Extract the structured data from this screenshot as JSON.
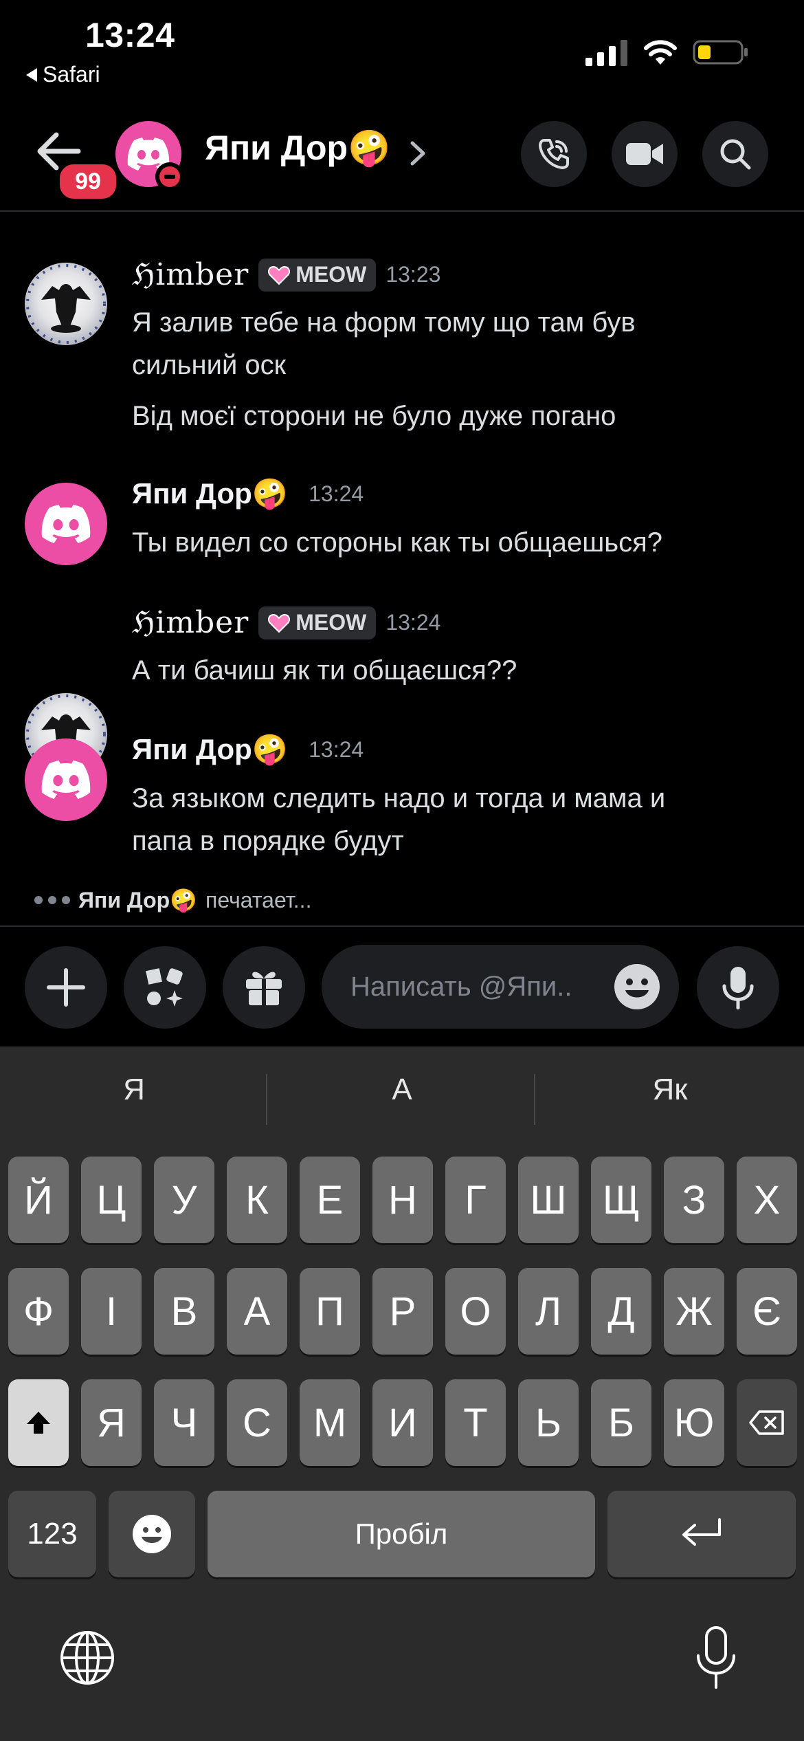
{
  "status": {
    "time": "13:24",
    "back_app": "Safari"
  },
  "header": {
    "badge": "99",
    "title": "Япи Дор🤪"
  },
  "messages": [
    {
      "author": "ℌimber",
      "tag": "MEOW",
      "time": "13:23",
      "lines": [
        "Я залив тебе на форм тому що там був",
        "сильний оск",
        "Від моєї сторони не було дуже погано"
      ]
    },
    {
      "author": "Япи Дор🤪",
      "time": "13:24",
      "lines": [
        "Ты видел со стороны как ты общаешься?"
      ]
    },
    {
      "author": "ℌimber",
      "tag": "MEOW",
      "time": "13:24",
      "lines": [
        "А ти бачиш як ти общаєшся??"
      ]
    },
    {
      "author": "Япи Дор🤪",
      "time": "13:24",
      "lines": [
        "За языком следить надо и тогда и мама и",
        "папа в порядке будут"
      ]
    }
  ],
  "typing": {
    "name": "Япи Дор🤪",
    "text": "печатает..."
  },
  "composer": {
    "placeholder": "Написать @Япи.."
  },
  "keyboard": {
    "suggestions": [
      "Я",
      "А",
      "Як"
    ],
    "row1": [
      "Й",
      "Ц",
      "У",
      "К",
      "Е",
      "Н",
      "Г",
      "Ш",
      "Щ",
      "З",
      "Х"
    ],
    "row2": [
      "Ф",
      "І",
      "В",
      "А",
      "П",
      "Р",
      "О",
      "Л",
      "Д",
      "Ж",
      "Є"
    ],
    "row3": [
      "Я",
      "Ч",
      "С",
      "М",
      "И",
      "Т",
      "Ь",
      "Б",
      "Ю"
    ],
    "numbers_label": "123",
    "space_label": "Пробіл"
  },
  "icons": {
    "header": [
      "back-arrow-icon",
      "discord-icon",
      "dnd-status-icon",
      "chevron-right-icon",
      "phone-call-icon",
      "video-camera-icon",
      "search-icon"
    ],
    "composer": [
      "plus-icon",
      "apps-icon",
      "gift-icon",
      "emoji-icon",
      "microphone-icon"
    ],
    "keyboard": [
      "shift-icon",
      "backspace-icon",
      "emoji-icon",
      "return-icon",
      "globe-icon",
      "dictation-icon"
    ]
  },
  "colors": {
    "accent": "#ed4ea5",
    "badge": "#e5334b",
    "background": "#000000"
  }
}
